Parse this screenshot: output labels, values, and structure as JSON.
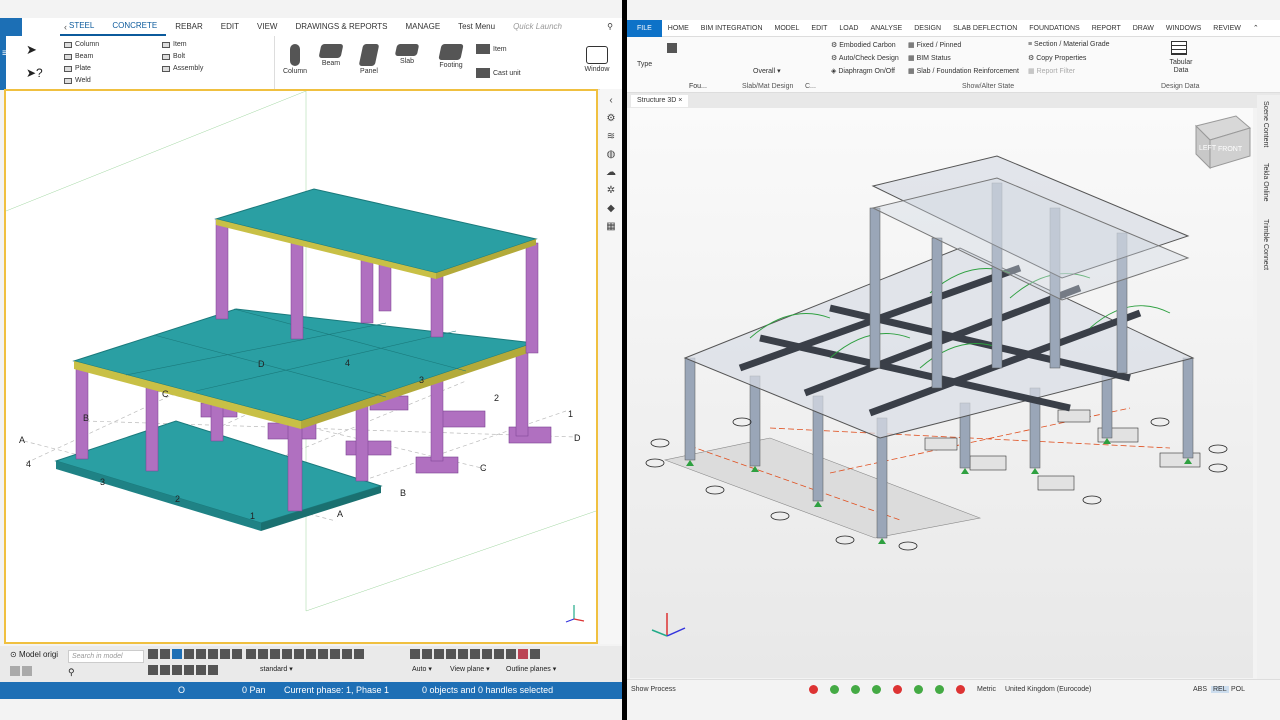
{
  "left_app": {
    "tabs": [
      "STEEL",
      "CONCRETE",
      "REBAR",
      "EDIT",
      "VIEW",
      "DRAWINGS & REPORTS",
      "MANAGE",
      "Test Menu"
    ],
    "quick_launch_placeholder": "Quick Launch",
    "ribbon": {
      "steel_items": [
        "Column",
        "Beam",
        "Plate",
        "Weld"
      ],
      "part_items": [
        "Item",
        "Bolt",
        "Assembly"
      ],
      "big_buttons": [
        "Column",
        "Beam",
        "Panel",
        "Slab",
        "Footing"
      ],
      "item_label": "Item",
      "cast_unit_label": "Cast unit",
      "window_label": "Window"
    },
    "grid_labels": {
      "letters": [
        "A",
        "B",
        "C",
        "D",
        "A",
        "B",
        "C",
        "D"
      ],
      "numbers": [
        "4",
        "3",
        "2",
        "1",
        "1",
        "2",
        "3",
        "4"
      ]
    },
    "bottom": {
      "model_origin": "Model origi",
      "search_placeholder": "Search in model",
      "standard": "standard",
      "auto": "Auto",
      "view_plane": "View plane",
      "outline_planes": "Outline planes"
    },
    "status": {
      "o": "O",
      "pan": "0 Pan",
      "phase": "Current phase: 1, Phase 1",
      "selection": "0 objects and 0 handles selected"
    }
  },
  "right_app": {
    "tabs": [
      "FILE",
      "HOME",
      "BIM INTEGRATION",
      "MODEL",
      "EDIT",
      "LOAD",
      "ANALYSE",
      "DESIGN",
      "SLAB DEFLECTION",
      "FOUNDATIONS",
      "REPORT",
      "DRAW",
      "WINDOWS",
      "REVIEW"
    ],
    "ribbon": {
      "type": "Type",
      "fou": "Fou...",
      "overall": "Overall",
      "slab_mat": "Slab/Mat Design",
      "c": "C...",
      "embodied": "Embodied Carbon",
      "auto_check": "Auto/Check Design",
      "diaphragm": "Diaphragm On/Off",
      "fixed": "Fixed / Pinned",
      "bim_status": "BIM Status",
      "slab_found": "Slab / Foundation Reinforcement",
      "section": "Section / Material Grade",
      "copy_props": "Copy Properties",
      "report_filter": "Report Filter",
      "show_alter": "Show/Alter State",
      "tabular": "Tabular Data",
      "design_data": "Design Data"
    },
    "view_tab": "Structure 3D",
    "view_cube": {
      "left": "LEFT",
      "front": "FRONT"
    },
    "side_panels": [
      "Scene Content",
      "Tekla Online",
      "Trimble Connect"
    ],
    "status": {
      "show_process": "Show Process",
      "metric": "Metric",
      "region": "United Kingdom (Eurocode)",
      "abs": "ABS",
      "rel": "REL",
      "pol": "POL"
    },
    "status_dot_colors": [
      "#d33",
      "#4a4",
      "#4a4",
      "#4a4",
      "#d33",
      "#4a4",
      "#4a4",
      "#d33"
    ]
  },
  "colors": {
    "slab": "#2a9fa3",
    "column": "#b070c0",
    "accent": "#1e6fb5"
  }
}
